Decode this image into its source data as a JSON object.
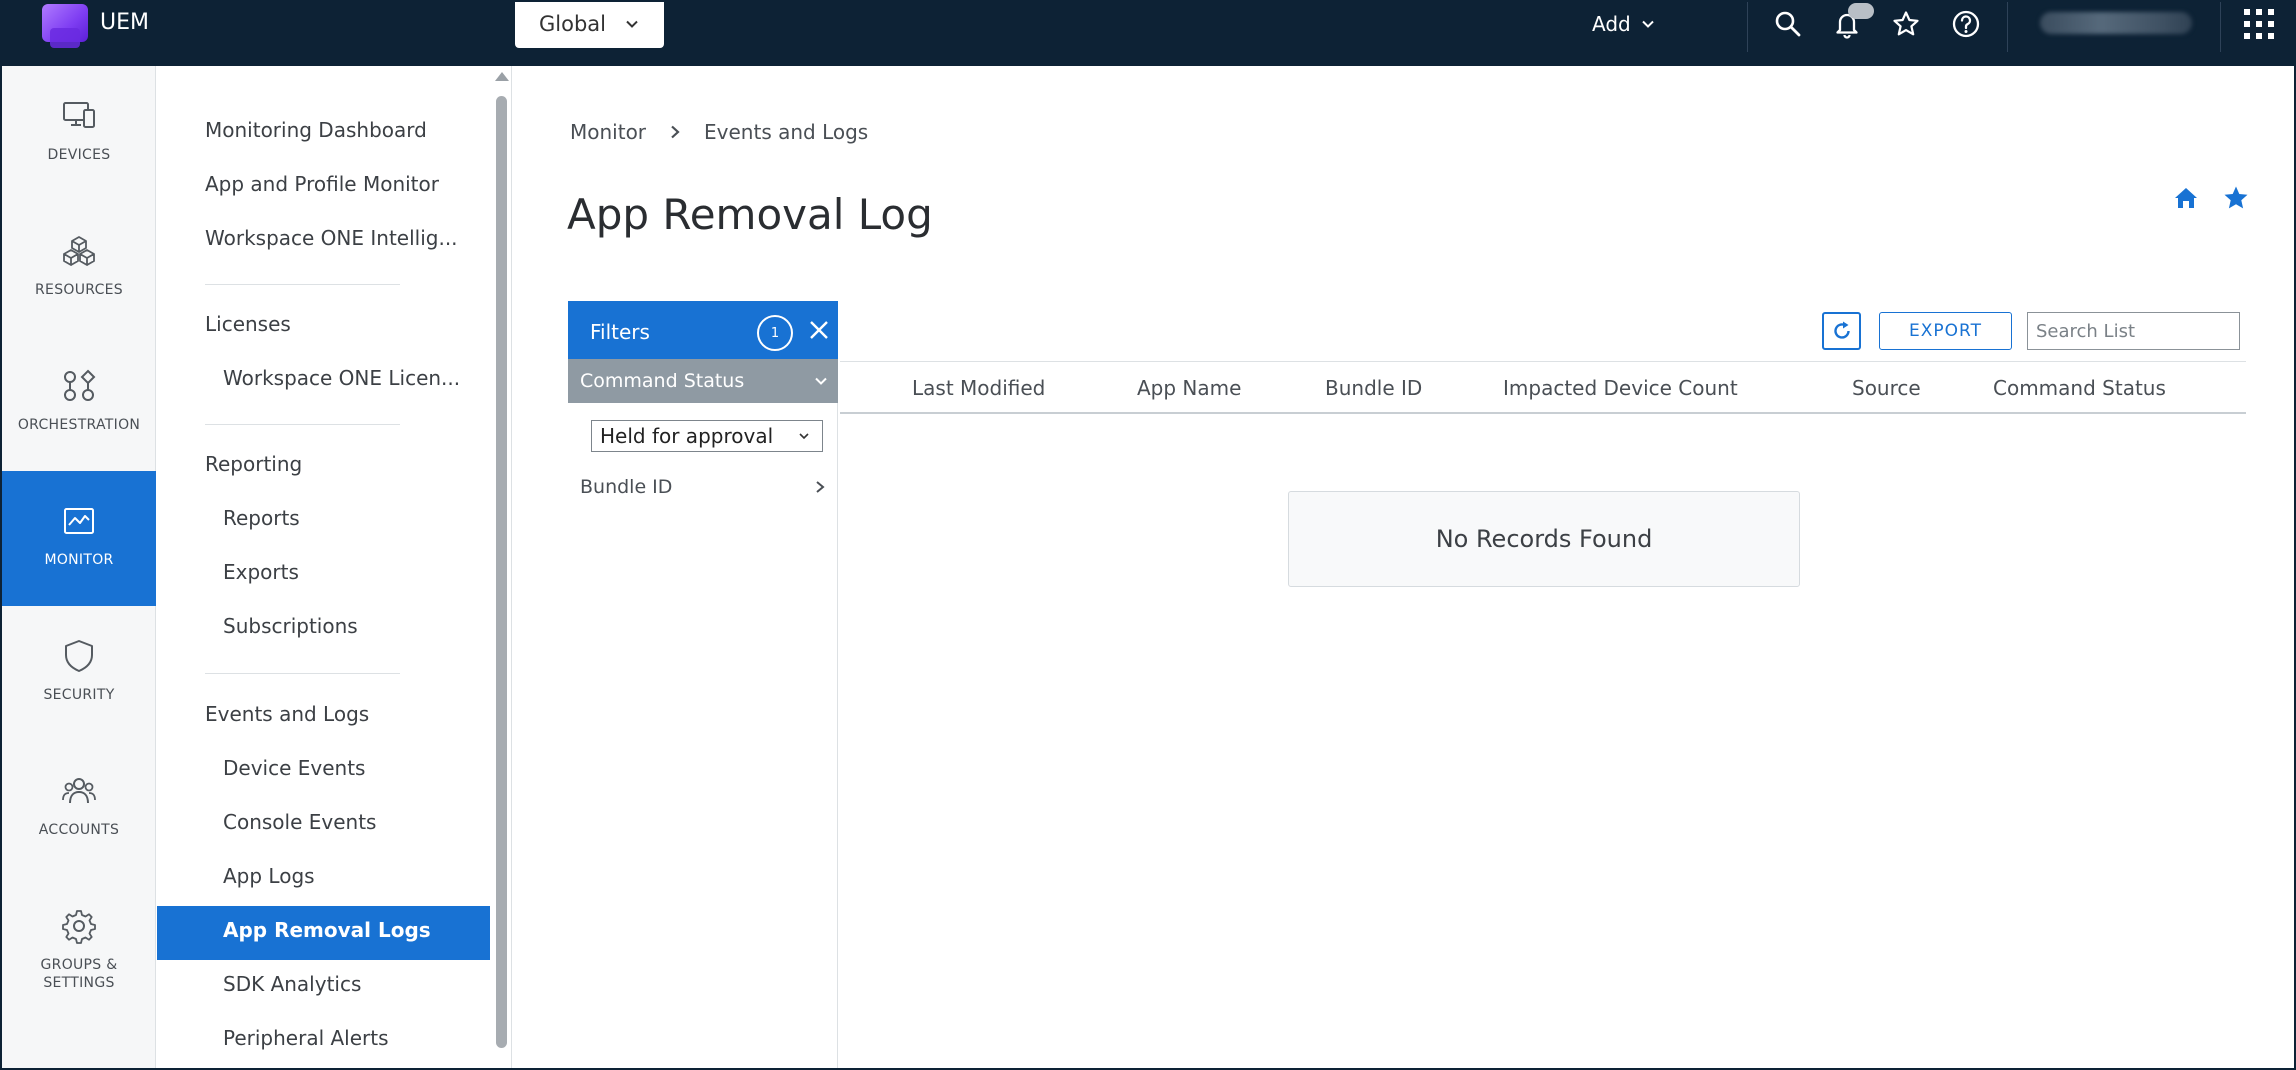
{
  "topbar": {
    "app_name": "UEM",
    "org_selector": "Global",
    "add_label": "Add",
    "icons": [
      "search-icon",
      "bell-icon",
      "star-icon",
      "help-icon",
      "apps-grid-icon"
    ],
    "colors": {
      "background": "#0d2235"
    }
  },
  "rail": {
    "items": [
      {
        "label": "DEVICES",
        "icon": "devices-icon"
      },
      {
        "label": "RESOURCES",
        "icon": "resources-icon"
      },
      {
        "label": "ORCHESTRATION",
        "icon": "orchestration-icon"
      },
      {
        "label": "MONITOR",
        "icon": "monitor-icon",
        "active": true
      },
      {
        "label": "SECURITY",
        "icon": "shield-icon"
      },
      {
        "label": "ACCOUNTS",
        "icon": "accounts-icon"
      },
      {
        "label": "GROUPS &",
        "label2": "SETTINGS",
        "icon": "gear-icon"
      }
    ]
  },
  "subnav": {
    "top_items": [
      "Monitoring Dashboard",
      "App and Profile Monitor",
      "Workspace ONE Intellig..."
    ],
    "licenses": {
      "heading": "Licenses",
      "items": [
        "Workspace ONE Licen..."
      ]
    },
    "reporting": {
      "heading": "Reporting",
      "items": [
        "Reports",
        "Exports",
        "Subscriptions"
      ]
    },
    "events": {
      "heading": "Events and Logs",
      "items": [
        "Device Events",
        "Console Events",
        "App Logs",
        "App Removal Logs",
        "SDK Analytics",
        "Peripheral Alerts"
      ]
    }
  },
  "breadcrumb": {
    "parent": "Monitor",
    "current": "Events and Logs"
  },
  "page_title": "App Removal Log",
  "filters": {
    "title": "Filters",
    "count": "1",
    "command_status_label": "Command Status",
    "command_status_value": "Held for approval",
    "bundle_id_label": "Bundle ID"
  },
  "toolbar": {
    "export_label": "EXPORT",
    "search_placeholder": "Search List"
  },
  "table": {
    "columns": [
      "Last Modified",
      "App Name",
      "Bundle ID",
      "Impacted Device Count",
      "Source",
      "Command Status"
    ],
    "empty_message": "No Records Found"
  },
  "colors": {
    "accent": "#1872d3",
    "filter_section": "#8f9aa3"
  }
}
